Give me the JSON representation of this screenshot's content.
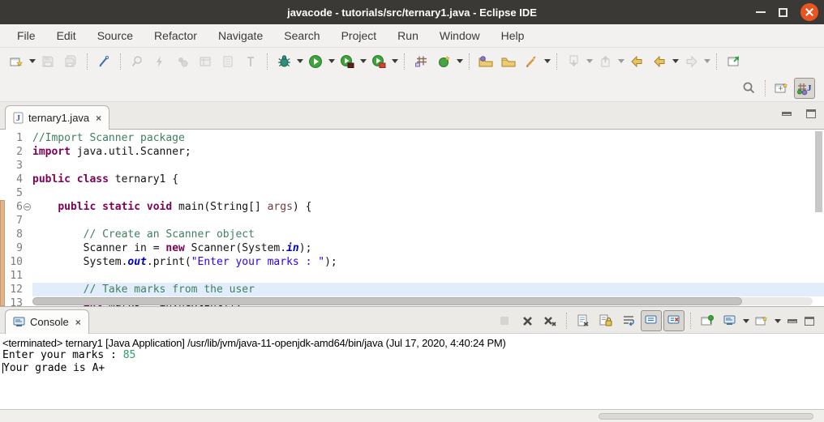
{
  "window": {
    "title": "javacode - tutorials/src/ternary1.java - Eclipse IDE"
  },
  "menubar": {
    "items": [
      "File",
      "Edit",
      "Source",
      "Refactor",
      "Navigate",
      "Search",
      "Project",
      "Run",
      "Window",
      "Help"
    ]
  },
  "toolbar": {
    "main_icons": [
      {
        "name": "new-wizard-icon",
        "enabled": true,
        "dropdown": true
      },
      {
        "name": "save-icon",
        "enabled": false
      },
      {
        "name": "save-all-icon",
        "enabled": false
      },
      {
        "name": "mark-occurrences-icon",
        "enabled": true
      },
      {
        "name": "pin-search-icon",
        "enabled": false
      },
      {
        "name": "lightning-icon",
        "enabled": false
      },
      {
        "name": "sync-icon",
        "enabled": false
      },
      {
        "name": "table-icon",
        "enabled": false
      },
      {
        "name": "list-icon",
        "enabled": false
      },
      {
        "name": "pillar-icon",
        "enabled": false
      },
      {
        "name": "debug-icon",
        "enabled": true,
        "dropdown": true
      },
      {
        "name": "run-icon",
        "enabled": true,
        "dropdown": true
      },
      {
        "name": "coverage-icon",
        "enabled": true,
        "dropdown": true
      },
      {
        "name": "profile-icon",
        "enabled": true,
        "dropdown": true
      },
      {
        "name": "new-java-project-icon",
        "enabled": true
      },
      {
        "name": "new-java-class-icon",
        "enabled": true,
        "dropdown": true
      },
      {
        "name": "open-task-icon",
        "enabled": true
      },
      {
        "name": "open-resource-icon",
        "enabled": true
      },
      {
        "name": "open-element-icon",
        "enabled": true,
        "dropdown": true
      },
      {
        "name": "next-annotation-icon",
        "enabled": false,
        "dropdown": true
      },
      {
        "name": "previous-annotation-icon",
        "enabled": false,
        "dropdown": true
      },
      {
        "name": "last-edit-location-icon",
        "enabled": true
      },
      {
        "name": "back-icon",
        "enabled": true,
        "dropdown": true
      },
      {
        "name": "forward-icon",
        "enabled": false,
        "dropdown": true
      },
      {
        "name": "pin-editor-icon",
        "enabled": true
      }
    ],
    "right_icons": [
      "search-icon",
      "open-perspective-icon",
      "java-perspective-icon"
    ],
    "java_perspective_active": true
  },
  "icons": {
    "java_glyph": "J",
    "close_glyph": "×"
  },
  "editor": {
    "tab_label": "ternary1.java",
    "current_line": 12,
    "folded_marker_line": 6,
    "lines": [
      {
        "num": 1,
        "tokens": [
          {
            "t": "comment",
            "s": "//Import Scanner package"
          }
        ]
      },
      {
        "num": 2,
        "tokens": [
          {
            "t": "keyword",
            "s": "import"
          },
          {
            "t": "plain",
            "s": " java.util.Scanner;"
          }
        ]
      },
      {
        "num": 3,
        "tokens": []
      },
      {
        "num": 4,
        "tokens": [
          {
            "t": "keyword",
            "s": "public class"
          },
          {
            "t": "plain",
            "s": " ternary1 {"
          }
        ]
      },
      {
        "num": 5,
        "tokens": []
      },
      {
        "num": 6,
        "tokens": [
          {
            "t": "plain",
            "s": "    "
          },
          {
            "t": "keyword",
            "s": "public static void"
          },
          {
            "t": "plain",
            "s": " main(String[] "
          },
          {
            "t": "param",
            "s": "args"
          },
          {
            "t": "plain",
            "s": ") {"
          }
        ]
      },
      {
        "num": 7,
        "tokens": []
      },
      {
        "num": 8,
        "tokens": [
          {
            "t": "plain",
            "s": "        "
          },
          {
            "t": "comment",
            "s": "// Create an Scanner object"
          }
        ]
      },
      {
        "num": 9,
        "tokens": [
          {
            "t": "plain",
            "s": "        Scanner in = "
          },
          {
            "t": "keyword",
            "s": "new"
          },
          {
            "t": "plain",
            "s": " Scanner(System."
          },
          {
            "t": "staticfield",
            "s": "in"
          },
          {
            "t": "plain",
            "s": ");"
          }
        ]
      },
      {
        "num": 10,
        "tokens": [
          {
            "t": "plain",
            "s": "        System."
          },
          {
            "t": "staticfield",
            "s": "out"
          },
          {
            "t": "plain",
            "s": ".print("
          },
          {
            "t": "string",
            "s": "\"Enter your marks : \""
          },
          {
            "t": "plain",
            "s": ");"
          }
        ]
      },
      {
        "num": 11,
        "tokens": []
      },
      {
        "num": 12,
        "tokens": [
          {
            "t": "plain",
            "s": "        "
          },
          {
            "t": "comment",
            "s": "// Take marks from the user"
          }
        ]
      },
      {
        "num": 13,
        "tokens": [
          {
            "t": "plain",
            "s": "        "
          },
          {
            "t": "keyword",
            "s": "int"
          },
          {
            "t": "plain",
            "s": " marks = in.nextInt();"
          }
        ]
      }
    ]
  },
  "console": {
    "tab_label": "Console",
    "toolbar_icons": [
      "terminate-icon",
      "remove-launch-icon",
      "remove-all-launches-icon",
      "clear-console-icon",
      "scroll-lock-icon",
      "word-wrap-icon",
      "show-stdout-toggle-icon",
      "show-stderr-toggle-icon",
      "pin-console-icon",
      "display-selected-console-icon",
      "open-console-icon",
      "minimize-view-icon",
      "maximize-view-icon"
    ],
    "header_line": "<terminated> ternary1 [Java Application] /usr/lib/jvm/java-11-openjdk-amd64/bin/java (Jul 17, 2020, 4:40:24 PM)",
    "output_lines": [
      {
        "caret": false,
        "segments": [
          {
            "t": "stdout",
            "s": "Enter your marks : "
          },
          {
            "t": "stdin",
            "s": "85"
          }
        ]
      },
      {
        "caret": true,
        "segments": [
          {
            "t": "stdout",
            "s": "Your grade is A+"
          }
        ]
      }
    ]
  },
  "colors": {
    "titlebar_bg": "#3a3935",
    "close_button": "#e95420",
    "keyword": "#7f0055",
    "comment": "#3f8060",
    "string": "#2a00ff",
    "static_field": "#0000c0",
    "current_line_bg": "#e2edfb",
    "range_indicator": "#e2b48c",
    "stdin_green": "#2f9e68"
  }
}
